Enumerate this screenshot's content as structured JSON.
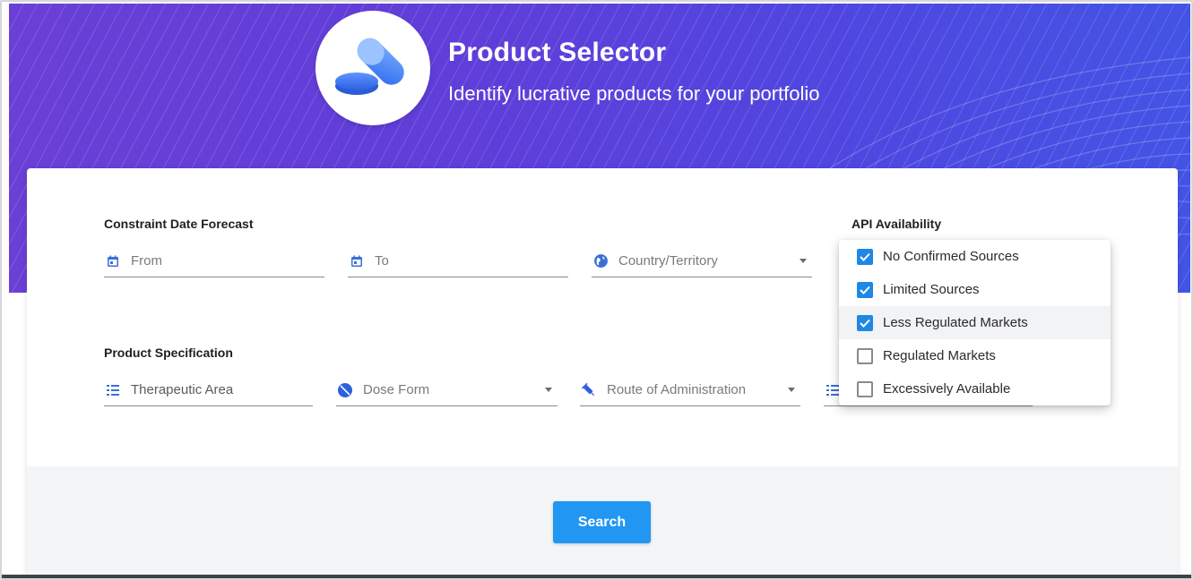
{
  "header": {
    "title": "Product Selector",
    "subtitle": "Identify lucrative products for your portfolio",
    "logo_icon": "pills-icon",
    "gradient_colors": [
      "#6a3fd6",
      "#4354e4"
    ]
  },
  "constraint_section": {
    "label": "Constraint Date Forecast",
    "from_placeholder": "From",
    "to_placeholder": "To",
    "country_placeholder": "Country/Territory"
  },
  "api_section": {
    "label": "API Availability",
    "options": [
      {
        "label": "No Confirmed Sources",
        "checked": true
      },
      {
        "label": "Limited Sources",
        "checked": true
      },
      {
        "label": "Less Regulated Markets",
        "checked": true
      },
      {
        "label": "Regulated Markets",
        "checked": false
      },
      {
        "label": "Excessively Available",
        "checked": false
      }
    ]
  },
  "product_section": {
    "label": "Product Specification",
    "therapeutic_placeholder": "Therapeutic Area",
    "dose_form_placeholder": "Dose Form",
    "route_placeholder": "Route of Administration"
  },
  "actions": {
    "search_label": "Search"
  },
  "colors": {
    "accent": "#2196f3",
    "checkbox": "#1e88e5"
  }
}
